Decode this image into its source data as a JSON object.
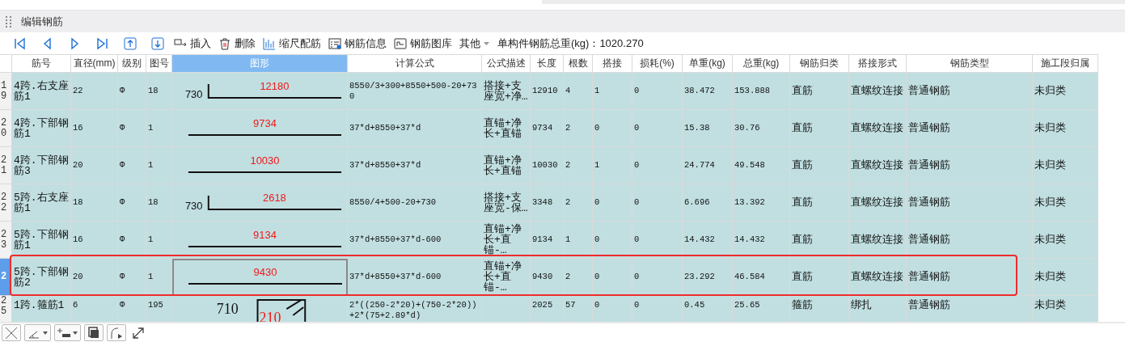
{
  "panel": {
    "title": "编辑钢筋"
  },
  "toolbar": {
    "buttons": [
      {
        "label": "插入",
        "kind": "button"
      },
      {
        "label": "删除",
        "kind": "button"
      },
      {
        "label": "缩尺配筋",
        "kind": "button"
      },
      {
        "label": "钢筋信息",
        "kind": "button"
      },
      {
        "label": "钢筋图库",
        "kind": "button"
      },
      {
        "label": "其他",
        "kind": "dropdown"
      }
    ],
    "total_weight": "单构件钢筋总重(kg)：1020.270"
  },
  "table": {
    "columns": [
      {
        "label": "筋号",
        "selected": false
      },
      {
        "label": "直径(mm)",
        "selected": false
      },
      {
        "label": "级别",
        "selected": false
      },
      {
        "label": "图号",
        "selected": false
      },
      {
        "label": "图形",
        "selected": true
      },
      {
        "label": "计算公式",
        "selected": false
      },
      {
        "label": "公式描述",
        "selected": false
      },
      {
        "label": "长度",
        "selected": false
      },
      {
        "label": "根数",
        "selected": false
      },
      {
        "label": "搭接",
        "selected": false
      },
      {
        "label": "损耗(%)",
        "selected": false
      },
      {
        "label": "单重(kg)",
        "selected": false
      },
      {
        "label": "总重(kg)",
        "selected": false
      },
      {
        "label": "钢筋归类",
        "selected": false
      },
      {
        "label": "搭接形式",
        "selected": false
      },
      {
        "label": "钢筋类型",
        "selected": false
      },
      {
        "label": "施工段归属",
        "selected": false
      }
    ],
    "rows": [
      {
        "index": "19",
        "selected": false,
        "name": "4跨.右支座筋1",
        "diameter": "22",
        "grade": "Φ",
        "shape_no": "18",
        "shape": {
          "kind": "hook",
          "leg": "730",
          "length": "12180"
        },
        "formula": "8550/3+300+8550+500-20+730",
        "description": "搭接+支座宽+净…",
        "length": "12910",
        "count": "4",
        "laps": "1",
        "loss": "0",
        "unit_weight": "38.472",
        "total_weight": "153.888",
        "category": "直筋",
        "lap_type": "直螺纹连接",
        "rebar_type": "普通钢筋",
        "stage": "未归类"
      },
      {
        "index": "20",
        "selected": false,
        "name": "4跨.下部钢筋1",
        "diameter": "16",
        "grade": "Φ",
        "shape_no": "1",
        "shape": {
          "kind": "straight",
          "length": "9734"
        },
        "formula": "37*d+8550+37*d",
        "description": "直锚+净长+直锚",
        "length": "9734",
        "count": "2",
        "laps": "0",
        "loss": "0",
        "unit_weight": "15.38",
        "total_weight": "30.76",
        "category": "直筋",
        "lap_type": "直螺纹连接",
        "rebar_type": "普通钢筋",
        "stage": "未归类"
      },
      {
        "index": "21",
        "selected": false,
        "name": "4跨.下部钢筋3",
        "diameter": "20",
        "grade": "Φ",
        "shape_no": "1",
        "shape": {
          "kind": "straight",
          "length": "10030"
        },
        "formula": "37*d+8550+37*d",
        "description": "直锚+净长+直锚",
        "length": "10030",
        "count": "2",
        "laps": "1",
        "loss": "0",
        "unit_weight": "24.774",
        "total_weight": "49.548",
        "category": "直筋",
        "lap_type": "直螺纹连接",
        "rebar_type": "普通钢筋",
        "stage": "未归类"
      },
      {
        "index": "22",
        "selected": false,
        "name": "5跨.右支座筋1",
        "diameter": "18",
        "grade": "Φ",
        "shape_no": "18",
        "shape": {
          "kind": "hook",
          "leg": "730",
          "length": "2618"
        },
        "formula": "8550/4+500-20+730",
        "description": "搭接+支座宽-保…",
        "length": "3348",
        "count": "2",
        "laps": "0",
        "loss": "0",
        "unit_weight": "6.696",
        "total_weight": "13.392",
        "category": "直筋",
        "lap_type": "直螺纹连接",
        "rebar_type": "普通钢筋",
        "stage": "未归类"
      },
      {
        "index": "23",
        "selected": false,
        "name": "5跨.下部钢筋1",
        "diameter": "16",
        "grade": "Φ",
        "shape_no": "1",
        "shape": {
          "kind": "straight",
          "length": "9134"
        },
        "formula": "37*d+8550+37*d-600",
        "description": "直锚+净长+直锚-…",
        "length": "9134",
        "count": "1",
        "laps": "0",
        "loss": "0",
        "unit_weight": "14.432",
        "total_weight": "14.432",
        "category": "直筋",
        "lap_type": "直螺纹连接",
        "rebar_type": "普通钢筋",
        "stage": "未归类"
      },
      {
        "index": "2",
        "selected": true,
        "name": "5跨.下部钢筋2",
        "diameter": "20",
        "grade": "Φ",
        "shape_no": "1",
        "shape": {
          "kind": "straight",
          "length": "9430"
        },
        "formula": "37*d+8550+37*d-600",
        "description": "直锚+净长+直锚-…",
        "length": "9430",
        "count": "2",
        "laps": "0",
        "loss": "0",
        "unit_weight": "23.292",
        "total_weight": "46.584",
        "category": "直筋",
        "lap_type": "直螺纹连接",
        "rebar_type": "普通钢筋",
        "stage": "未归类"
      },
      {
        "index": "25",
        "selected": false,
        "name": "1跨.箍筋1",
        "diameter": "6",
        "grade": "Φ",
        "shape_no": "195",
        "shape": {
          "kind": "stirrup",
          "width_label": "710",
          "height_label": "210"
        },
        "formula": "2*((250-2*20)+(750-2*20))+2*(75+2.89*d)",
        "length": "2025",
        "count": "57",
        "laps": "0",
        "loss": "0",
        "unit_weight": "0.45",
        "total_weight": "25.65",
        "category": "箍筋",
        "lap_type": "绑扎",
        "rebar_type": "普通钢筋",
        "stage": "未归类"
      }
    ]
  }
}
